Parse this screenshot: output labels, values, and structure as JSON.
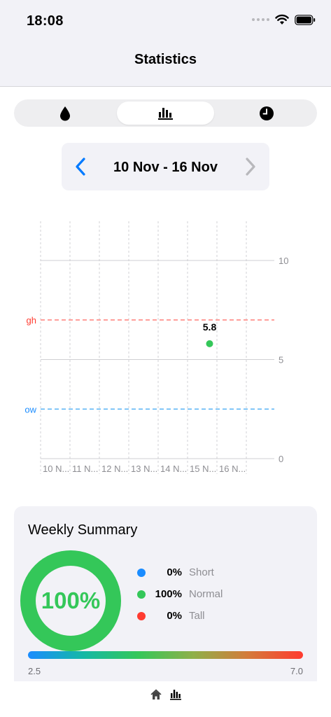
{
  "status_bar": {
    "time": "18:08",
    "icons": [
      "signal-icon",
      "wifi-icon",
      "battery-icon"
    ]
  },
  "nav": {
    "title": "Statistics"
  },
  "segments": [
    {
      "icon": "drop-icon",
      "selected": false
    },
    {
      "icon": "bar-chart-icon",
      "selected": true
    },
    {
      "icon": "clock-icon",
      "selected": false
    }
  ],
  "range": {
    "label": "10 Nov - 16 Nov",
    "prev_icon": "chevron-left-icon",
    "next_icon": "chevron-right-icon"
  },
  "colors": {
    "accent": "#007aff",
    "normal": "#34c759",
    "short": "#1a8cff",
    "tall": "#ff3b30",
    "high_line": "#ff8a84",
    "low_line": "#5ab4f5"
  },
  "chart_data": {
    "type": "scatter",
    "categories": [
      "10 N...",
      "11 N...",
      "12 N...",
      "13 N...",
      "14 N...",
      "15 N...",
      "16 N..."
    ],
    "points": [
      {
        "x_index": 5.75,
        "y": 5.8,
        "label": "5.8"
      }
    ],
    "ylim": [
      0,
      10
    ],
    "yticks": [
      "0",
      "5",
      "10"
    ],
    "thresholds": [
      {
        "label": "High",
        "visible_text": "gh",
        "y": 7.0
      },
      {
        "label": "Low",
        "visible_text": "ow",
        "y": 2.5
      }
    ],
    "grid": true
  },
  "summary": {
    "title": "Weekly Summary",
    "donut_value": 1.0,
    "donut_label": "100%",
    "legend": [
      {
        "pct": "0%",
        "name": "Short",
        "color": "#1a8cff"
      },
      {
        "pct": "100%",
        "name": "Normal",
        "color": "#34c759"
      },
      {
        "pct": "0%",
        "name": "Tall",
        "color": "#ff3b30"
      }
    ],
    "scale_min": "2.5",
    "scale_max": "7.0"
  },
  "tabbar": {
    "items": [
      "home-icon",
      "bar-chart-icon"
    ]
  }
}
